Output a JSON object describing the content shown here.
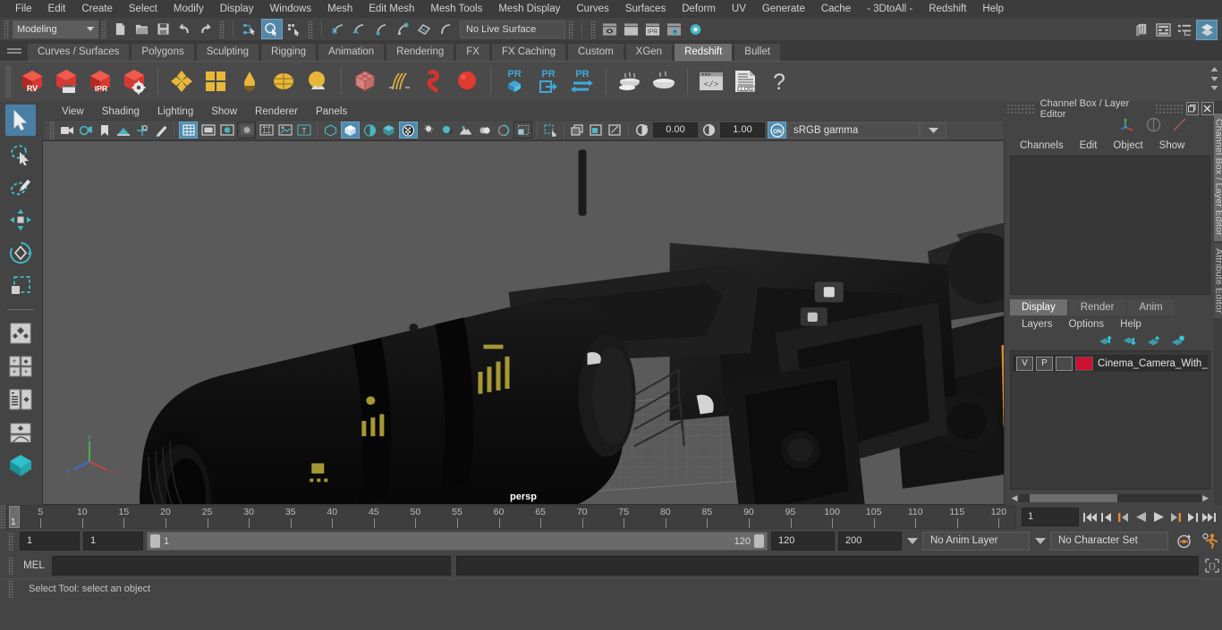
{
  "menubar": {
    "items": [
      "File",
      "Edit",
      "Create",
      "Select",
      "Modify",
      "Display",
      "Windows",
      "Mesh",
      "Edit Mesh",
      "Mesh Tools",
      "Mesh Display",
      "Curves",
      "Surfaces",
      "Deform",
      "UV",
      "Generate",
      "Cache",
      "- 3DtoAll -",
      "Redshift",
      "Help"
    ]
  },
  "statusline": {
    "menuset": "Modeling",
    "live_surface": "No Live Surface",
    "icons": [
      "new-scene-icon",
      "open-scene-icon",
      "save-scene-icon",
      "undo-icon",
      "redo-icon",
      "select-hierarchy-icon",
      "select-object-icon",
      "select-component-icon",
      "snap-grid-icon",
      "snap-curve-icon",
      "snap-point-icon",
      "snap-projected-center-icon",
      "snap-view-plane-icon",
      "make-live-icon",
      "render-view-icon",
      "render-frame-icon",
      "ipr-render-icon",
      "render-settings-icon",
      "hypershade-icon",
      "toggle-sidebar-icon",
      "attribute-editor-icon",
      "tool-settings-icon",
      "channel-box-icon"
    ]
  },
  "shelf": {
    "tabs": [
      "Curves / Surfaces",
      "Polygons",
      "Sculpting",
      "Rigging",
      "Animation",
      "Rendering",
      "FX",
      "FX Caching",
      "Custom",
      "XGen",
      "Redshift",
      "Bullet"
    ],
    "active_tab": "Redshift",
    "buttons": [
      "redshift-rv-icon",
      "redshift-rv-sequence-icon",
      "redshift-ipr-icon",
      "redshift-render-settings-icon",
      "redshift-material-icon",
      "redshift-texture-icon",
      "redshift-light-dome-icon",
      "redshift-environment-icon",
      "redshift-sun-sky-icon",
      "redshift-proxy-icon",
      "redshift-hair-icon",
      "redshift-volume-icon",
      "redshift-sphere-icon",
      "redshift-pr-object-icon",
      "redshift-pr-export-icon",
      "redshift-pr-transfer-icon",
      "redshift-bake-icon",
      "redshift-bake-set-icon",
      "redshift-script-icon",
      "redshift-log-icon",
      "redshift-help-icon"
    ]
  },
  "toolbox": {
    "items": [
      "select-tool",
      "lasso-select-tool",
      "paint-select-tool",
      "move-tool",
      "rotate-tool",
      "scale-tool",
      "last-tool",
      "layout-single-perspective",
      "layout-four-view",
      "layout-persp-outliner",
      "layout-persp-graph",
      "layout-hypershade"
    ],
    "active": "select-tool"
  },
  "viewport": {
    "panel_menu": [
      "View",
      "Shading",
      "Lighting",
      "Show",
      "Renderer",
      "Panels"
    ],
    "camera_label": "persp",
    "toolbar": {
      "exposure": "0.00",
      "gamma": "1.00",
      "color_management": "sRGB gamma",
      "gamma_toggle": "ON",
      "icons": [
        "select-camera-icon",
        "camera-attributes-icon",
        "bookmark-icon",
        "image-plane-icon",
        "2d-pan-zoom-icon",
        "grease-pencil-icon",
        "grid-icon",
        "film-gate-icon",
        "resolution-gate-icon",
        "gate-mask-icon",
        "field-chart-icon",
        "safe-action-icon",
        "safe-title-icon",
        "wireframe-icon",
        "smooth-shade-icon",
        "shaded-wireframe-icon",
        "textured-icon",
        "use-all-lights-icon",
        "shadows-icon",
        "screen-space-ao-icon",
        "motion-blur-icon",
        "multisample-icon",
        "depth-of-field-icon",
        "isolate-select-icon",
        "xray-icon",
        "xray-joints-icon",
        "xray-active-components-icon",
        "exposure-icon",
        "gamma-icon",
        "view-transform-icon"
      ]
    }
  },
  "dock": {
    "title": "Channel Box / Layer Editor",
    "vertical_tabs": [
      "Channel Box / Layer Editor",
      "Attribute Editor"
    ],
    "channelbox": {
      "menus": [
        "Channels",
        "Edit",
        "Object",
        "Show"
      ],
      "icons": [
        "manipulator-icon",
        "gray-circle-icon",
        "red-line-icon"
      ]
    },
    "layereditor": {
      "tabs": [
        "Display",
        "Render",
        "Anim"
      ],
      "active_tab": "Display",
      "menus": [
        "Layers",
        "Options",
        "Help"
      ],
      "buttons": [
        "move-layer-up-icon",
        "move-layer-down-icon",
        "new-layer-icon",
        "new-layer-from-selected-icon"
      ],
      "layers": [
        {
          "visibility": "V",
          "playback": "P",
          "shading": "",
          "color": "#cc1133",
          "name": "Cinema_Camera_With_"
        }
      ]
    }
  },
  "timeline": {
    "ticks": [
      5,
      10,
      15,
      20,
      25,
      30,
      35,
      40,
      45,
      50,
      55,
      60,
      65,
      70,
      75,
      80,
      85,
      90,
      95,
      100,
      105,
      110,
      115,
      120
    ],
    "current_frame_marker": "1",
    "current_frame_field": "1",
    "playback_buttons": [
      "go-to-start-icon",
      "step-back-keyframe-icon",
      "step-back-frame-icon",
      "play-backwards-icon",
      "play-forwards-icon",
      "step-forward-frame-icon",
      "step-forward-keyframe-icon",
      "go-to-end-icon"
    ]
  },
  "rangeslider": {
    "anim_start": "1",
    "range_start": "1",
    "bar_start": "1",
    "bar_end": "120",
    "range_end": "120",
    "anim_end": "200",
    "anim_layer": "No Anim Layer",
    "character_set": "No Character Set",
    "icons": [
      "auto-keyframe-icon",
      "animation-preferences-icon"
    ]
  },
  "commandline": {
    "language": "MEL",
    "input_value": "",
    "output_value": "",
    "icon": "script-editor-icon"
  },
  "helpline": {
    "text": "Select Tool: select an object"
  },
  "colors": {
    "accent_blue": "#4f8bb0",
    "panel_bg": "#444444",
    "viewport_bg": "#5a5a5a",
    "layer_color": "#cc1133",
    "orange": "#e0892e"
  }
}
